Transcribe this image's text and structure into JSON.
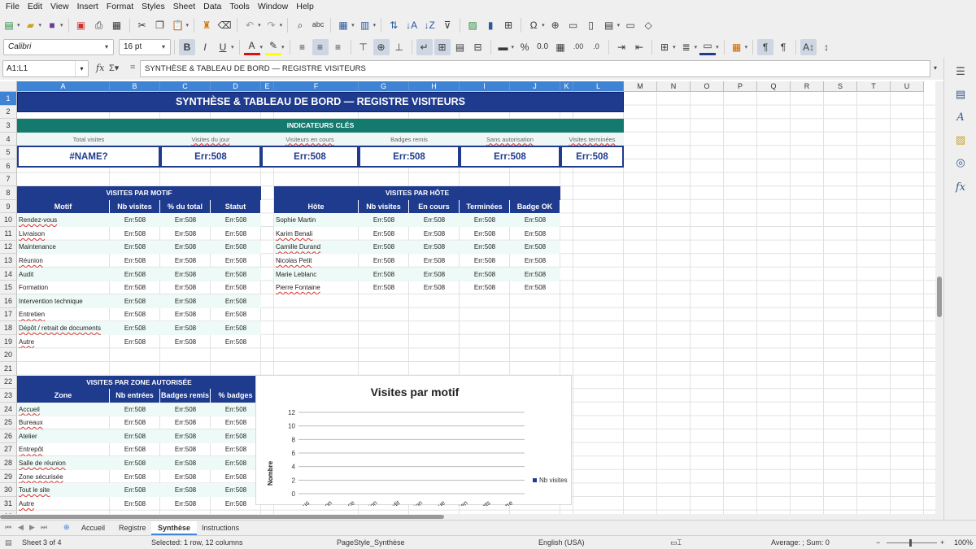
{
  "menu": [
    "File",
    "Edit",
    "View",
    "Insert",
    "Format",
    "Styles",
    "Sheet",
    "Data",
    "Tools",
    "Window",
    "Help"
  ],
  "toolbar": {
    "font_name": "Calibri",
    "font_size": "16 pt"
  },
  "formula_bar": {
    "name_box": "A1:L1",
    "content": "SYNTHÈSE & TABLEAU DE BORD — REGISTRE VISITEURS"
  },
  "columns": [
    "A",
    "B",
    "C",
    "D",
    "E",
    "F",
    "G",
    "H",
    "I",
    "J",
    "K",
    "L",
    "M",
    "N",
    "O",
    "P",
    "Q",
    "R",
    "S",
    "T",
    "U"
  ],
  "rows": [
    "1",
    "2",
    "3",
    "4",
    "5",
    "6",
    "7",
    "8",
    "9",
    "10",
    "11",
    "12",
    "13",
    "14",
    "15",
    "16",
    "17",
    "18",
    "19",
    "20",
    "21",
    "22",
    "23",
    "24",
    "25",
    "26",
    "27",
    "28",
    "29",
    "30",
    "31",
    "32"
  ],
  "sheet": {
    "title": "SYNTHÈSE & TABLEAU DE BORD — REGISTRE VISITEURS",
    "kpi_section": "INDICATEURS CLÉS",
    "kpis": [
      {
        "label": "Total visites",
        "value": "#NAME?"
      },
      {
        "label": "Visites du jour",
        "value": "Err:508"
      },
      {
        "label": "Visiteurs en cours",
        "value": "Err:508"
      },
      {
        "label": "Badges remis",
        "value": "Err:508"
      },
      {
        "label": "Sans autorisation",
        "value": "Err:508"
      },
      {
        "label": "Visites terminées",
        "value": "Err:508"
      }
    ],
    "motif_section": "VISITES PAR MOTIF",
    "motif_headers": [
      "Motif",
      "Nb visites",
      "% du total",
      "Statut"
    ],
    "motifs": [
      "Rendez-vous",
      "Livraison",
      "Maintenance",
      "Réunion",
      "Audit",
      "Formation",
      "Intervention technique",
      "Entretien",
      "Dépôt / retrait de documents",
      "Autre"
    ],
    "host_section": "VISITES PAR HÔTE",
    "host_headers": [
      "Hôte",
      "Nb visites",
      "En cours",
      "Terminées",
      "Badge OK"
    ],
    "hosts": [
      "Sophie Martin",
      "Karim Benali",
      "Camille Durand",
      "Nicolas Petit",
      "Marie Leblanc",
      "Pierre Fontaine"
    ],
    "zone_section": "VISITES PAR ZONE AUTORISÉE",
    "zone_headers": [
      "Zone",
      "Nb entrées",
      "Badges remis",
      "% badges"
    ],
    "zones": [
      "Accueil",
      "Bureaux",
      "Atelier",
      "Entrepôt",
      "Salle de réunion",
      "Zone sécurisée",
      "Tout le site",
      "Autre"
    ],
    "err": "Err:508"
  },
  "chart_data": {
    "type": "bar",
    "title": "Visites par motif",
    "ylabel": "Nombre",
    "xlabel": "",
    "ylim": [
      0,
      12
    ],
    "yticks": [
      0,
      2,
      4,
      6,
      8,
      10,
      12
    ],
    "categories": [
      "Rendez-vous",
      "Livraison",
      "Maintenance",
      "Réunion",
      "Audit",
      "Formation",
      "Intervention technique",
      "Entretien",
      "Dépôt / retrait de documents",
      "Autre"
    ],
    "series": [
      {
        "name": "Nb visites",
        "values": [
          0,
          0,
          0,
          0,
          0,
          0,
          0,
          0,
          0,
          0
        ]
      }
    ],
    "legend": "right",
    "series_color": "#1f3b8e"
  },
  "tabs": [
    "Accueil",
    "Registre",
    "Synthèse",
    "Instructions"
  ],
  "active_tab": "Synthèse",
  "status": {
    "sheet": "Sheet 3 of 4",
    "selection": "Selected: 1 row, 12 columns",
    "page_style": "PageStyle_Synthèse",
    "language": "English (USA)",
    "summary": "Average: ; Sum: 0",
    "zoom": "100%"
  }
}
